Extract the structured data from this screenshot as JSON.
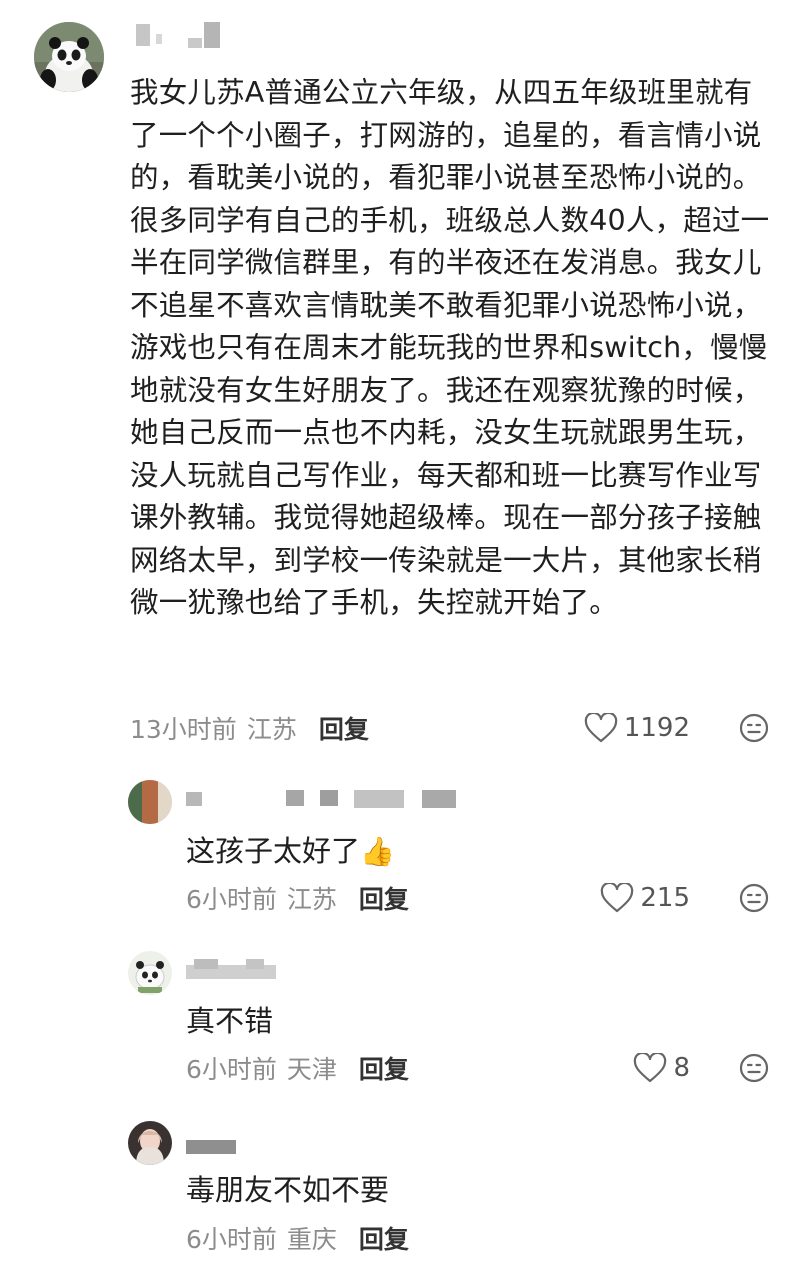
{
  "main_comment": {
    "body": "我女儿苏A普通公立六年级，从四五年级班里就有了一个个小圈子，打网游的，追星的，看言情小说的，看耽美小说的，看犯罪小说甚至恐怖小说的。很多同学有自己的手机，班级总人数40人，超过一半在同学微信群里，有的半夜还在发消息。我女儿不追星不喜欢言情耽美不敢看犯罪小说恐怖小说，游戏也只有在周末才能玩我的世界和switch，慢慢地就没有女生好朋友了。我还在观察犹豫的时候，她自己反而一点也不内耗，没女生玩就跟男生玩，没人玩就自己写作业，每天都和班一比赛写作业写课外教辅。我觉得她超级棒。现在一部分孩子接触网络太早，到学校一传染就是一大片，其他家长稍微一犹豫也给了手机，失控就开始了。",
    "time": "13小时前",
    "region": "江苏",
    "reply_label": "回复",
    "likes": "1192"
  },
  "replies": [
    {
      "text": "这孩子太好了",
      "emoji": "👍",
      "time": "6小时前",
      "region": "江苏",
      "reply_label": "回复",
      "likes": "215"
    },
    {
      "text": "真不错",
      "time": "6小时前",
      "region": "天津",
      "reply_label": "回复",
      "likes": "8"
    },
    {
      "text": "毒朋友不如不要",
      "time": "6小时前",
      "region": "重庆",
      "reply_label": "回复",
      "likes": ""
    }
  ],
  "colors": {
    "meta_gray": "#8c8c8c",
    "text": "#1f1f1f",
    "icon": "#666666"
  },
  "icons": {
    "like": "heart-outline-icon",
    "react": "smiley-icon"
  }
}
